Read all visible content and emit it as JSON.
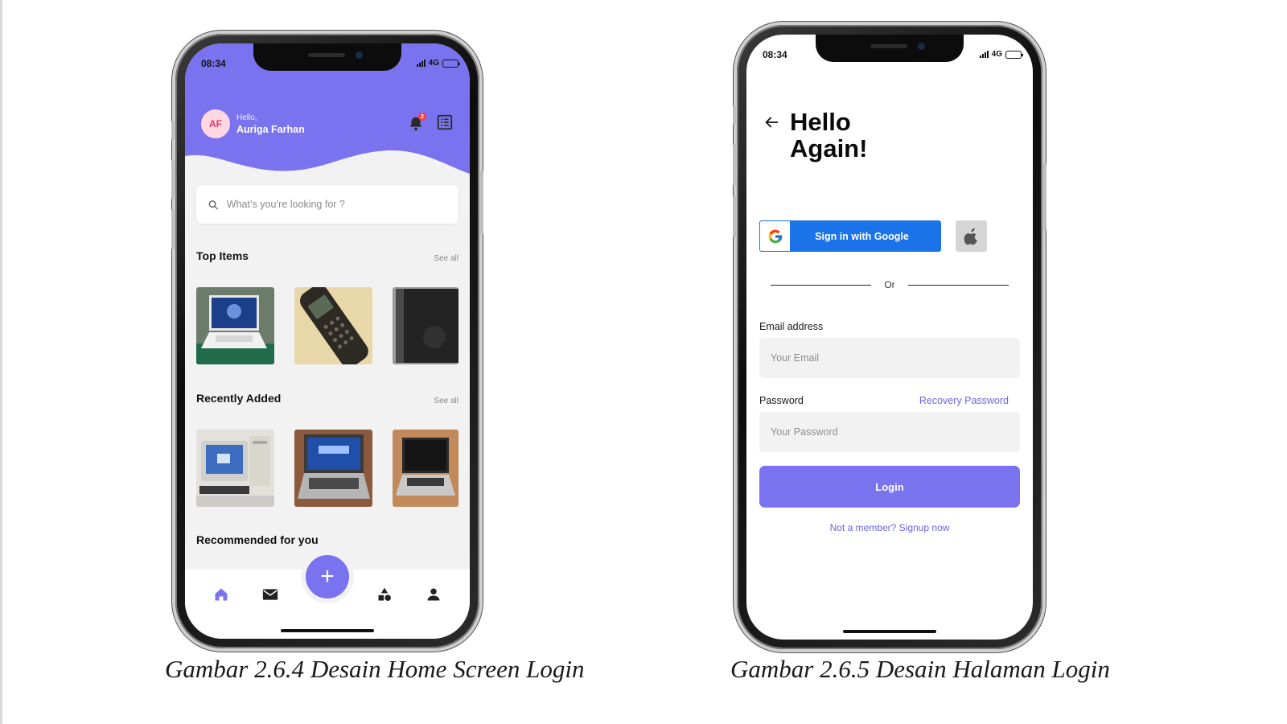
{
  "captions": {
    "left": "Gambar 2.6.4 Desain Home Screen Login",
    "right": "Gambar 2.6.5 Desain Halaman Login"
  },
  "colors": {
    "accent": "#7a73ef",
    "google_blue": "#1a73e8",
    "link": "#6b64e6",
    "avatar_bg": "#ffd6e3",
    "avatar_text": "#e8336b",
    "notification_badge": "#ff3b3b"
  },
  "home_screen": {
    "status": {
      "time": "08:34",
      "network": "4G"
    },
    "header": {
      "avatar_initials": "AF",
      "greeting": "Hello,",
      "user_name": "Auriga Farhan",
      "notification_count": "2",
      "icons": [
        "bell-icon",
        "list-icon"
      ]
    },
    "search": {
      "placeholder": "What’s you’re looking for ?",
      "icon": "search-icon"
    },
    "sections": {
      "top_items": {
        "title": "Top Items",
        "see_all": "See all",
        "items": [
          "laptop-white-photo",
          "old-cellphone-photo",
          "dark-device-photo"
        ]
      },
      "recently_added": {
        "title": "Recently Added",
        "see_all": "See all",
        "items": [
          "crt-desktop-pc-photo",
          "dell-laptop-photo",
          "silver-laptop-photo"
        ]
      },
      "recommended": {
        "title": "Recommended for you"
      }
    },
    "fab": {
      "label": "+"
    },
    "nav": [
      "home-icon",
      "mail-icon",
      "add-fab",
      "shapes-icon",
      "user-icon"
    ]
  },
  "login_screen": {
    "status": {
      "time": "08:34",
      "network": "4G"
    },
    "heading_line1": "Hello",
    "heading_line2": "Again!",
    "google_button": "Sign in with Google",
    "apple_button_icon": "apple-icon",
    "divider": "Or",
    "email": {
      "label": "Email address",
      "placeholder": "Your Email"
    },
    "password": {
      "label": "Password",
      "placeholder": "Your Password",
      "recovery_link": "Recovery Password"
    },
    "login_button": "Login",
    "signup_link": "Not a member? Signup now"
  }
}
